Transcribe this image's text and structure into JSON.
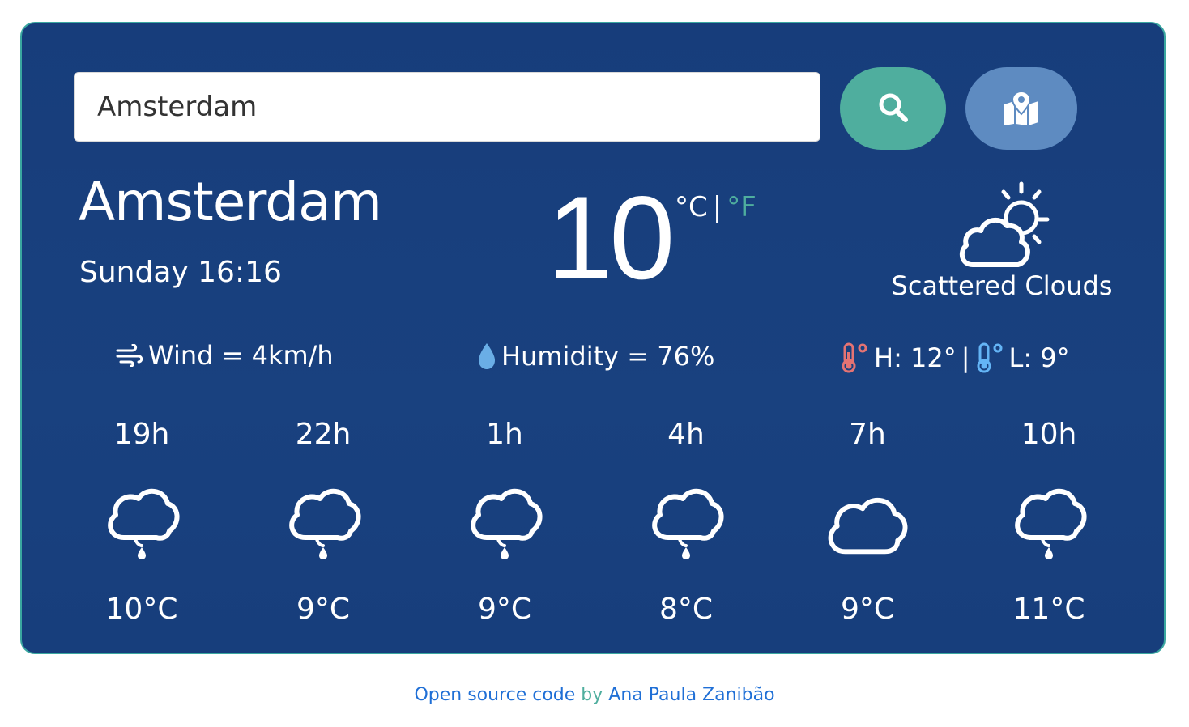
{
  "search": {
    "value": "Amsterdam",
    "search_button_icon": "search-icon",
    "map_button_icon": "map-icon"
  },
  "current": {
    "city": "Amsterdam",
    "datetime": "Sunday 16:16",
    "temperature": "10",
    "unit_c": "°C",
    "unit_separator": "|",
    "unit_f": "°F",
    "condition": "Scattered Clouds",
    "condition_icon": "partly-cloudy-icon"
  },
  "stats": {
    "wind": "Wind = 4km/h",
    "humidity": "Humidity = 76%",
    "high": "H: 12°",
    "separator": "|",
    "low": "L: 9°"
  },
  "forecast": [
    {
      "hour": "19h",
      "temp": "10°C",
      "icon": "drizzle-cloud-icon"
    },
    {
      "hour": "22h",
      "temp": "9°C",
      "icon": "drizzle-cloud-icon"
    },
    {
      "hour": "1h",
      "temp": "9°C",
      "icon": "drizzle-cloud-icon"
    },
    {
      "hour": "4h",
      "temp": "8°C",
      "icon": "drizzle-cloud-icon"
    },
    {
      "hour": "7h",
      "temp": "9°C",
      "icon": "cloud-icon"
    },
    {
      "hour": "10h",
      "temp": "11°C",
      "icon": "drizzle-cloud-icon"
    }
  ],
  "footer": {
    "link_text": "Open source code",
    "by": "by",
    "author": "Ana Paula Zanibão"
  },
  "colors": {
    "card_bg": "#173d7b",
    "accent_teal": "#4fae9e",
    "map_button": "#5e8bc1",
    "high_temp_icon": "#e57373",
    "low_temp_icon": "#64b5f6",
    "link": "#1f6fd6"
  }
}
